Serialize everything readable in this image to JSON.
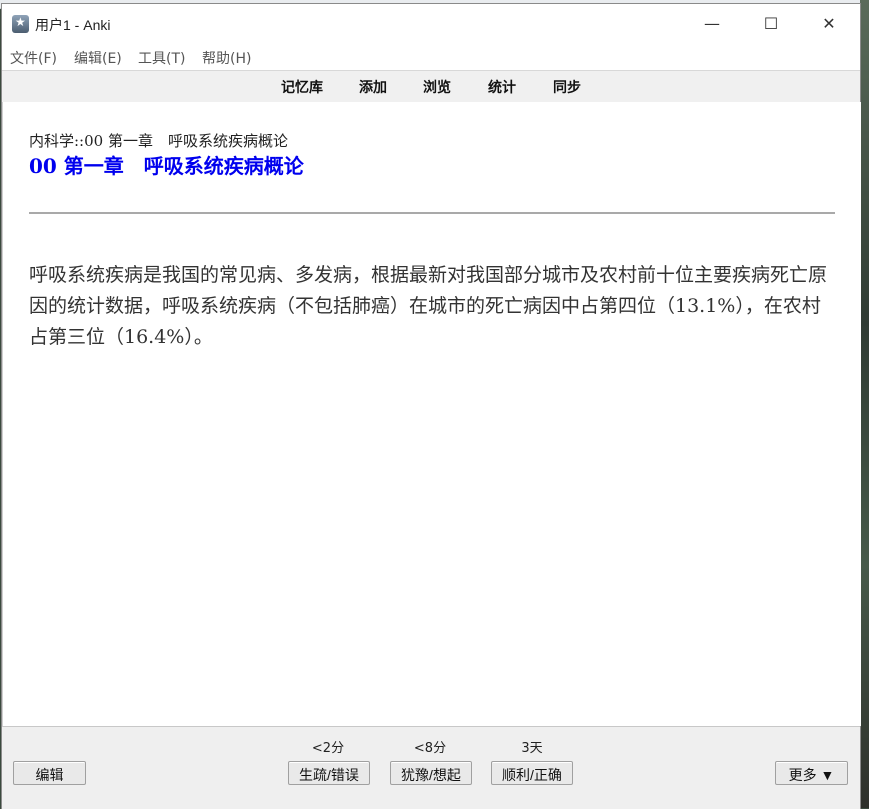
{
  "window": {
    "title": "用户1 - Anki",
    "minimize_glyph": "—",
    "maximize_glyph": "☐",
    "close_glyph": "✕"
  },
  "menu": [
    "文件(F)",
    "编辑(E)",
    "工具(T)",
    "帮助(H)"
  ],
  "toolbar": [
    "记忆库",
    "添加",
    "浏览",
    "统计",
    "同步"
  ],
  "card": {
    "deck_path": "内科学::00 第一章　呼吸系统疾病概论",
    "title": "00 第一章　呼吸系统疾病概论",
    "body": "呼吸系统疾病是我国的常见病、多发病，根据最新对我国部分城市及农村前十位主要疾病死亡原因的统计数据，呼吸系统疾病（不包括肺癌）在城市的死亡病因中占第四位（13.1%），在农村占第三位（16.4%）。"
  },
  "answer_bar": {
    "edit_label": "编辑",
    "intervals": [
      "<2分",
      "<8分",
      "3天"
    ],
    "answers": [
      "生疏/错误",
      "犹豫/想起",
      "顺利/正确"
    ],
    "more_label": "更多 ▼"
  },
  "colors": {
    "title_blue": "#0000ee",
    "toolbar_bg": "#f0f0f0"
  },
  "icons": [
    "anki-app-icon"
  ]
}
